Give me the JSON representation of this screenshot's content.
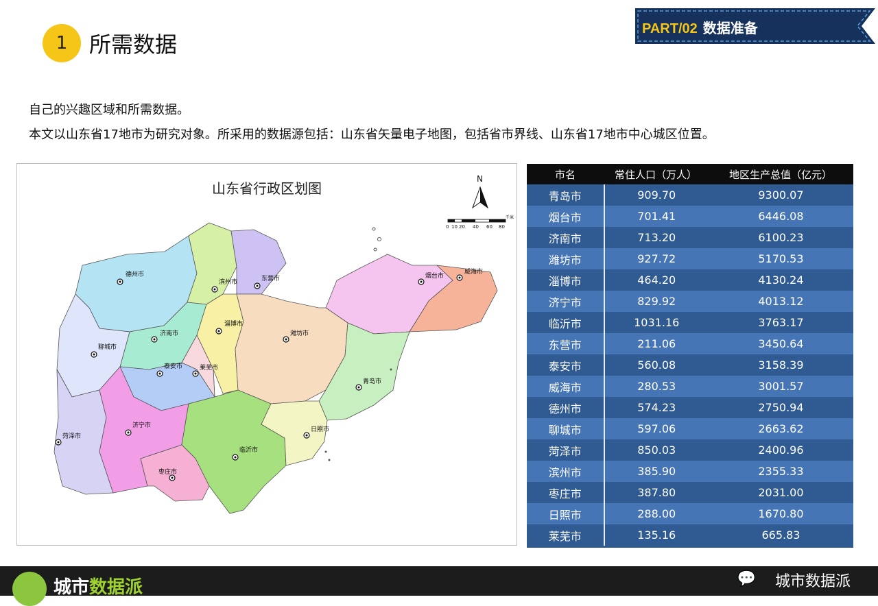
{
  "header": {
    "section_number": "1",
    "section_title": "所需数据",
    "part_label": "PART/02",
    "part_title": "数据准备"
  },
  "intro": {
    "line1": "自己的兴趣区域和所需数据。",
    "line2": "本文以山东省17地市为研究对象。所采用的数据源包括：山东省矢量电子地图，包括省市界线、山东省17地市中心城区位置。"
  },
  "map": {
    "title": "山东省行政区划图",
    "north": "N",
    "scale_ticks": [
      "0",
      "10",
      "20",
      "40",
      "60",
      "80"
    ],
    "scale_unit": "千米",
    "cities": [
      {
        "name": "德州市",
        "color": "#b4e3f4"
      },
      {
        "name": "滨州市",
        "color": "#d6f0a6"
      },
      {
        "name": "东营市",
        "color": "#cdc2f3"
      },
      {
        "name": "烟台市",
        "color": "#f6c5ef"
      },
      {
        "name": "威海市",
        "color": "#f6b39a"
      },
      {
        "name": "济南市",
        "color": "#a7ecd2"
      },
      {
        "name": "淄博市",
        "color": "#f7f0a5"
      },
      {
        "name": "潍坊市",
        "color": "#f7dcc0"
      },
      {
        "name": "聊城市",
        "color": "#dfe5fb"
      },
      {
        "name": "泰安市",
        "color": "#b3cdf6"
      },
      {
        "name": "莱芜市",
        "color": "#f8d9de"
      },
      {
        "name": "青岛市",
        "color": "#c7efc0"
      },
      {
        "name": "菏泽市",
        "color": "#d6d3f5"
      },
      {
        "name": "济宁市",
        "color": "#f29ee6"
      },
      {
        "name": "临沂市",
        "color": "#a7e07e"
      },
      {
        "name": "日照市",
        "color": "#f3f5c4"
      },
      {
        "name": "枣庄市",
        "color": "#f6b0d3"
      }
    ]
  },
  "table": {
    "headers": [
      "市名",
      "常住人口（万人）",
      "地区生产总值（亿元）"
    ],
    "rows": [
      [
        "青岛市",
        "909.70",
        "9300.07"
      ],
      [
        "烟台市",
        "701.41",
        "6446.08"
      ],
      [
        "济南市",
        "713.20",
        "6100.23"
      ],
      [
        "潍坊市",
        "927.72",
        "5170.53"
      ],
      [
        "淄博市",
        "464.20",
        "4130.24"
      ],
      [
        "济宁市",
        "829.92",
        "4013.12"
      ],
      [
        "临沂市",
        "1031.16",
        "3763.17"
      ],
      [
        "东营市",
        "211.06",
        "3450.64"
      ],
      [
        "泰安市",
        "560.08",
        "3158.39"
      ],
      [
        "威海市",
        "280.53",
        "3001.57"
      ],
      [
        "德州市",
        "574.23",
        "2750.94"
      ],
      [
        "聊城市",
        "597.06",
        "2663.62"
      ],
      [
        "菏泽市",
        "850.03",
        "2400.96"
      ],
      [
        "滨州市",
        "385.90",
        "2355.33"
      ],
      [
        "枣庄市",
        "387.80",
        "2031.00"
      ],
      [
        "日照市",
        "288.00",
        "1670.80"
      ],
      [
        "莱芜市",
        "135.16",
        "665.83"
      ]
    ]
  },
  "footer": {
    "brand_part1": "城市",
    "brand_part2": "数据派",
    "wechat_name": "城市数据派"
  },
  "colors": {
    "accent": "#f5c518",
    "banner_bg": "#16325c",
    "table_dark": "#2f5b92",
    "table_light": "#4675b5",
    "footer_bg": "#1c1c1c"
  }
}
